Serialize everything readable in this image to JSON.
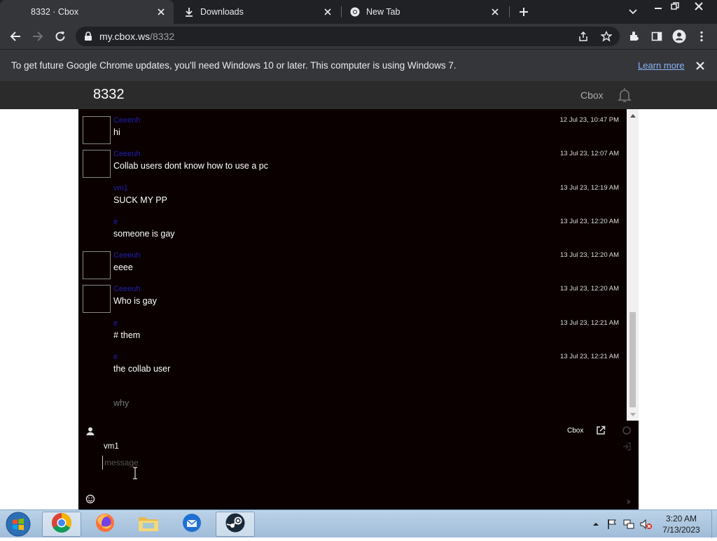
{
  "browser": {
    "tabs": [
      {
        "title": "8332 · Cbox",
        "active": true
      },
      {
        "title": "Downloads",
        "active": false
      },
      {
        "title": "New Tab",
        "active": false
      }
    ],
    "url_host": "my.cbox.ws",
    "url_path": "/8332"
  },
  "infobar": {
    "text": "To get future Google Chrome updates, you'll need Windows 10 or later. This computer is using Windows 7.",
    "link": "Learn more"
  },
  "page": {
    "title": "8332",
    "cbox_link": "Cbox"
  },
  "messages": [
    {
      "user": "Ceeenh",
      "text": "hi",
      "time": "12 Jul 23, 10:47 PM",
      "avatar": true
    },
    {
      "user": "Ceeeuh",
      "text": "Collab users dont know how to use a pc",
      "time": "13 Jul 23, 12:07 AM",
      "avatar": true
    },
    {
      "user": "vm1",
      "text": "SUCK MY PP",
      "time": "13 Jul 23, 12:19 AM",
      "avatar": false
    },
    {
      "user": "e",
      "text": "someone is gay",
      "time": "13 Jul 23, 12:20 AM",
      "avatar": false
    },
    {
      "user": "Ceeeuh",
      "text": "eeee",
      "time": "13 Jul 23, 12:20 AM",
      "avatar": true
    },
    {
      "user": "Ceeeuh",
      "text": "Who is gay",
      "time": "13 Jul 23, 12:20 AM",
      "avatar": true
    },
    {
      "user": "e",
      "text": "# them",
      "time": "13 Jul 23, 12:21 AM",
      "avatar": false
    },
    {
      "user": "e",
      "text": "the collab user",
      "time": "13 Jul 23, 12:21 AM",
      "avatar": false
    },
    {
      "user": "",
      "text": "why",
      "time": "",
      "avatar": false,
      "faded": true
    }
  ],
  "compose": {
    "cbox_label": "Cbox",
    "username": "vm1",
    "placeholder": "message"
  },
  "taskbar": {
    "time": "3:20 AM",
    "date": "7/13/2023"
  },
  "colors": {
    "chat_bg": "#0a0000",
    "username": "#2020b0",
    "chrome_dark": "#202124",
    "chrome_mid": "#35363a"
  }
}
